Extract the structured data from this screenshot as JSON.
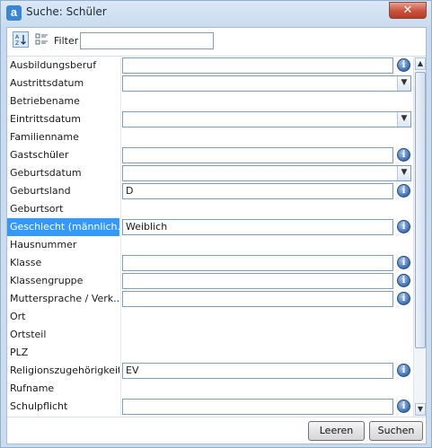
{
  "window": {
    "title": "Suche: Schüler",
    "close_glyph": "✕",
    "app_icon_letter": "a"
  },
  "toolbar": {
    "sort_icon": "sort-alphabetical-icon",
    "categorize_icon": "categorized-icon",
    "filter_label": "Filter",
    "filter_value": ""
  },
  "properties": [
    {
      "name": "Ausbildungsberuf",
      "type": "text",
      "value": "",
      "info": true
    },
    {
      "name": "Austrittsdatum",
      "type": "combo",
      "value": ""
    },
    {
      "name": "Betriebename",
      "type": "none"
    },
    {
      "name": "Eintrittsdatum",
      "type": "combo",
      "value": ""
    },
    {
      "name": "Familienname",
      "type": "none"
    },
    {
      "name": "Gastschüler",
      "type": "text",
      "value": "",
      "info": true
    },
    {
      "name": "Geburtsdatum",
      "type": "combo",
      "value": ""
    },
    {
      "name": "Geburtsland",
      "type": "text",
      "value": "D",
      "info": true
    },
    {
      "name": "Geburtsort",
      "type": "none"
    },
    {
      "name": "Geschlecht (männlich...",
      "type": "text",
      "value": "Weiblich",
      "info": true,
      "selected": true
    },
    {
      "name": "Hausnummer",
      "type": "none"
    },
    {
      "name": "Klasse",
      "type": "text",
      "value": "",
      "info": true
    },
    {
      "name": "Klassengruppe",
      "type": "text",
      "value": "",
      "info": true
    },
    {
      "name": "Muttersprache / Verk...",
      "type": "text",
      "value": "",
      "info": true
    },
    {
      "name": "Ort",
      "type": "none"
    },
    {
      "name": "Ortsteil",
      "type": "none"
    },
    {
      "name": "PLZ",
      "type": "none"
    },
    {
      "name": "Religionszugehörigkeit",
      "type": "text",
      "value": "EV",
      "info": true
    },
    {
      "name": "Rufname",
      "type": "none"
    },
    {
      "name": "Schulpflicht",
      "type": "text",
      "value": "",
      "info": true
    }
  ],
  "buttons": {
    "clear_label": "Leeren",
    "search_label": "Suchen"
  },
  "glyphs": {
    "info": "i",
    "combo_arrow": "▼",
    "scroll_up": "▲",
    "scroll_down": "▼"
  },
  "colors": {
    "selection": "#3399ff",
    "titlebar": "#cbdcee",
    "close": "#c9503a"
  }
}
